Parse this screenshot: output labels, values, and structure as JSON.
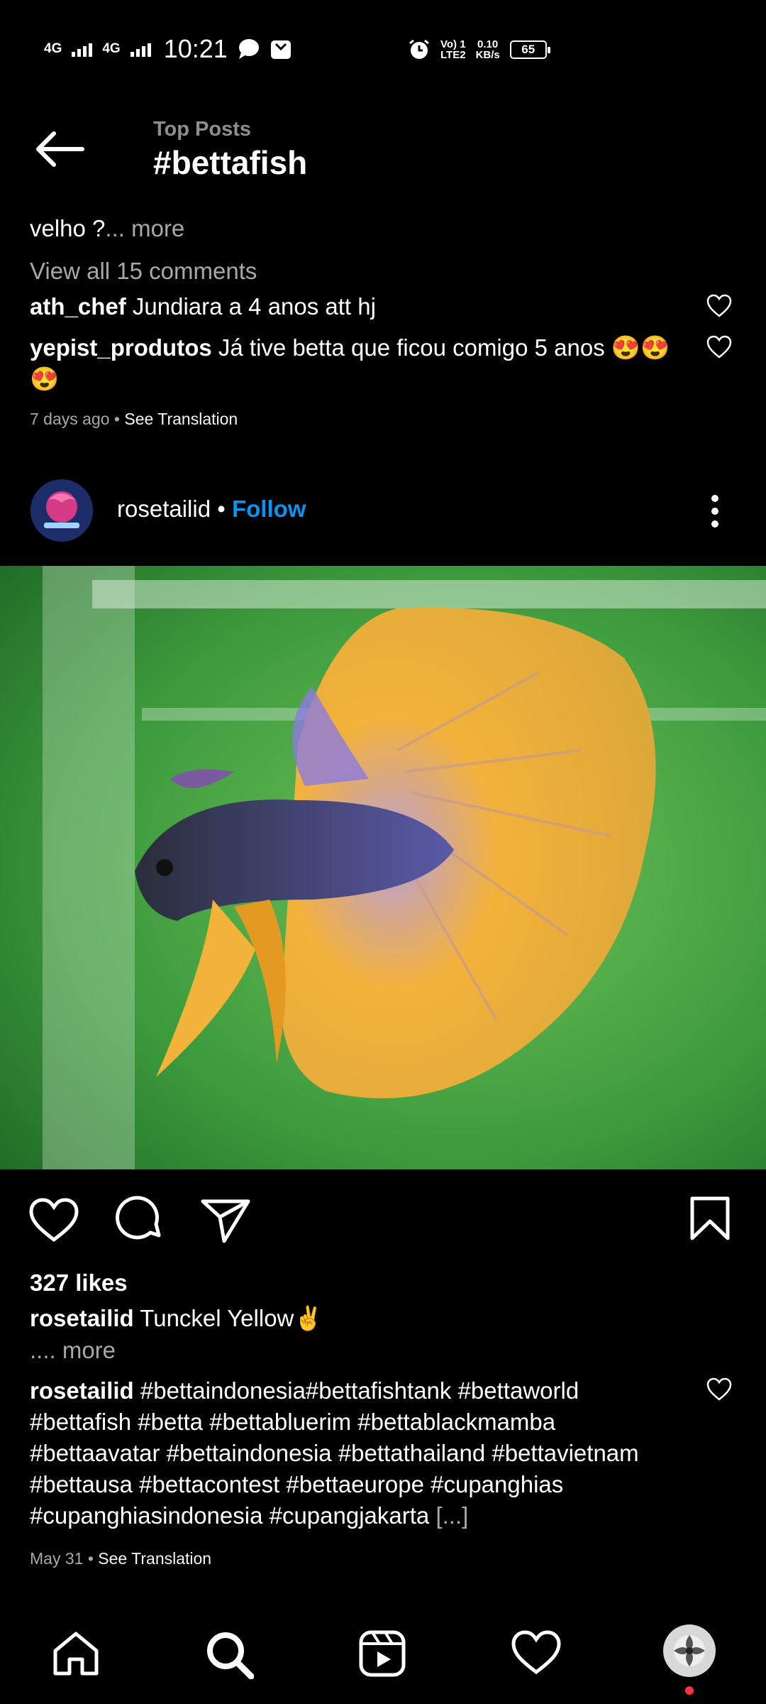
{
  "status_bar": {
    "network1": "4G",
    "network2": "4G",
    "time": "10:21",
    "volte": "Vo) 1",
    "lte": "LTE2",
    "speed_value": "0.10",
    "speed_unit": "KB/s",
    "battery": "65",
    "icons": [
      "message-bubble-icon",
      "notification-icon",
      "alarm-icon"
    ]
  },
  "header": {
    "subtitle": "Top Posts",
    "title": "#bettafish",
    "back_icon": "back-arrow-icon"
  },
  "prev_post": {
    "caption_tail": "velho ?",
    "more": "... more",
    "view_comments": "View all 15 comments",
    "comments": [
      {
        "user": "ath_chef",
        "text": "Jundiara  a 4 anos att hj"
      },
      {
        "user": "yepist_produtos",
        "text": "Já tive betta que ficou comigo 5 anos 😍😍",
        "text2": "😍"
      }
    ],
    "time": "7 days ago",
    "see_translation": "See Translation"
  },
  "post": {
    "username": "rosetailid",
    "dot": "•",
    "follow": "Follow",
    "likes": "327 likes",
    "caption_text": "Tunckel Yellow✌",
    "caption_more": ".... more",
    "comment_user": "rosetailid",
    "comment_lines": [
      "#bettaindonesia#bettafishtank #bettaworld",
      "#bettafish #betta #bettabluerim #bettablackmamba",
      "#bettaavatar #bettaindonesia #bettathailand #bettavietnam",
      "#bettausa #bettacontest #bettaeurope #cupanghias",
      "#cupanghiasindonesia #cupangjakarta"
    ],
    "ellipsis": "[...]",
    "date": "May 31",
    "see_translation": "See Translation",
    "colors": {
      "follow": "#0095f6",
      "fish_fin": "#f3b23a",
      "fish_body": "#4b4a8a",
      "background": "#3c9a3c"
    }
  },
  "bottom_nav": {
    "items": [
      "home-icon",
      "search-icon",
      "reels-icon",
      "activity-heart-icon",
      "profile-avatar"
    ]
  }
}
